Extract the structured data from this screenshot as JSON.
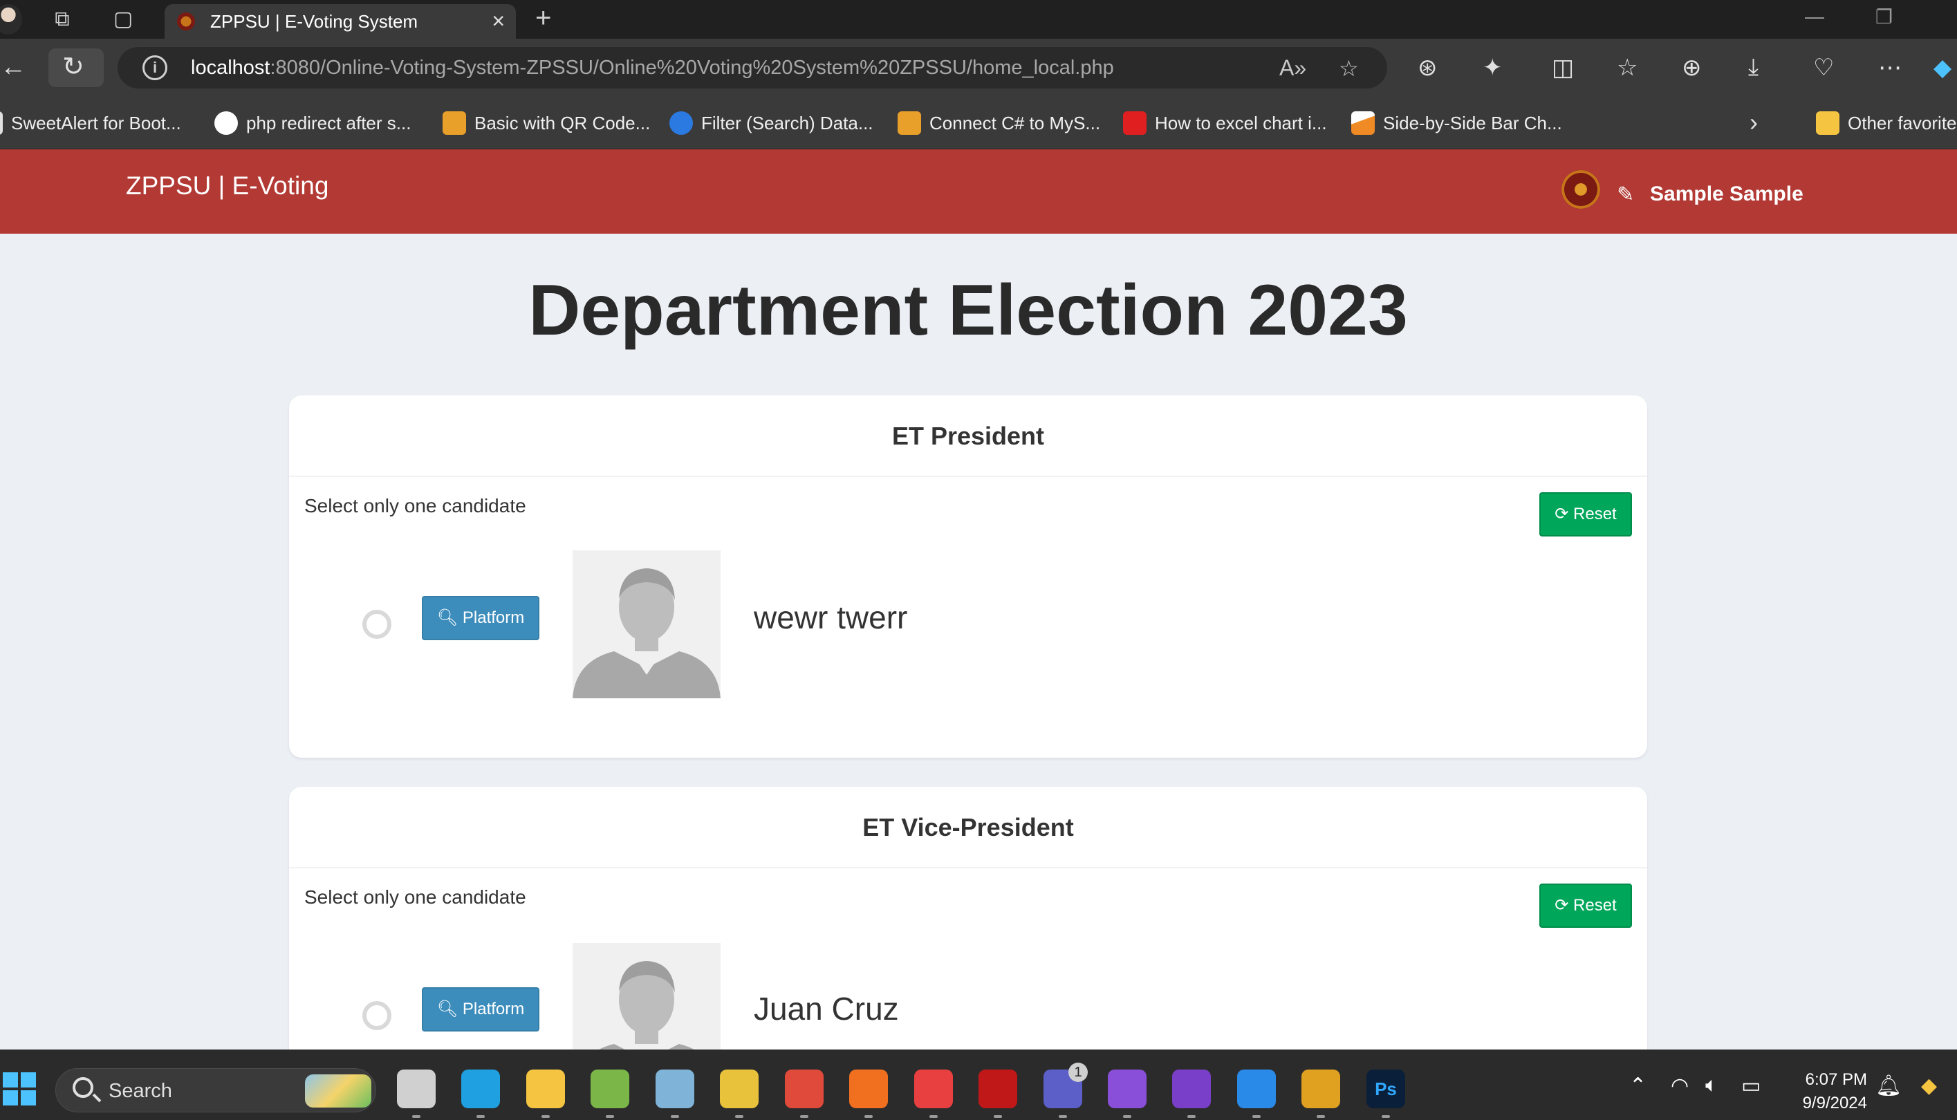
{
  "browser": {
    "active_tab_title": "ZPPSU | E-Voting System",
    "new_tab_symbol": "+",
    "url_host": "localhost",
    "url_rest": ":8080/Online-Voting-System-ZPSSU/Online%20Voting%20System%20ZPSSU/home_local.php",
    "bookmarks": [
      {
        "label": "SweetAlert for Boot...",
        "icon": "bookmark-page-icon",
        "color": "#e0e0e0"
      },
      {
        "label": "php redirect after s...",
        "icon": "github-icon",
        "color": "#ffffff"
      },
      {
        "label": "Basic with QR Code...",
        "icon": "codeproject-icon",
        "color": "#e8a02a"
      },
      {
        "label": "Filter (Search) Data...",
        "icon": "asp-icon",
        "color": "#2a7ae2"
      },
      {
        "label": "Connect C# to MyS...",
        "icon": "codeproject-icon",
        "color": "#e8a02a"
      },
      {
        "label": "How to excel chart i...",
        "icon": "n-logo-icon",
        "color": "#e02020"
      },
      {
        "label": "Side-by-Side Bar Ch...",
        "icon": "chart-icon",
        "color": "#f08a24"
      }
    ],
    "other_favorites_label": "Other favorite"
  },
  "site": {
    "brand": "ZPPSU | E-Voting",
    "user_name": "Sample Sample"
  },
  "page": {
    "title": "Department Election 2023"
  },
  "positions": [
    {
      "title": "ET President",
      "instruction": "Select only one candidate",
      "reset_label": "Reset",
      "candidates": [
        {
          "name": "wewr twerr",
          "platform_label": "Platform",
          "selected": false
        }
      ]
    },
    {
      "title": "ET Vice-President",
      "instruction": "Select only one candidate",
      "reset_label": "Reset",
      "candidates": [
        {
          "name": "Juan Cruz",
          "platform_label": "Platform",
          "selected": false
        }
      ]
    }
  ],
  "taskbar": {
    "search_label": "Search",
    "time": "6:07 PM",
    "date": "9/9/2024",
    "teams_badge": "1",
    "apps": [
      {
        "name": "task-view",
        "color": "#d0d0d0"
      },
      {
        "name": "edge",
        "color": "#1fa0e0"
      },
      {
        "name": "file-explorer",
        "color": "#f5c542"
      },
      {
        "name": "notepad-plus",
        "color": "#7ab648"
      },
      {
        "name": "app-blue",
        "color": "#7fb4d8"
      },
      {
        "name": "app-yellow",
        "color": "#e8c23a"
      },
      {
        "name": "chrome",
        "color": "#e04a3a"
      },
      {
        "name": "xampp",
        "color": "#f07020"
      },
      {
        "name": "anydesk",
        "color": "#e84040"
      },
      {
        "name": "filezilla",
        "color": "#c01818"
      },
      {
        "name": "teams",
        "color": "#5b5fc7"
      },
      {
        "name": "visual-studio",
        "color": "#8a4fd8"
      },
      {
        "name": "visual-studio-2",
        "color": "#7a3fc8"
      },
      {
        "name": "vscode",
        "color": "#2a8ae8"
      },
      {
        "name": "app-swirl",
        "color": "#e0a020"
      },
      {
        "name": "photoshop",
        "color": "#0a1f3a"
      }
    ]
  },
  "colors": {
    "header_red": "#b23934",
    "reset_green": "#00a65a",
    "platform_blue": "#3c8dbc",
    "page_bg": "#ecf0f5"
  }
}
